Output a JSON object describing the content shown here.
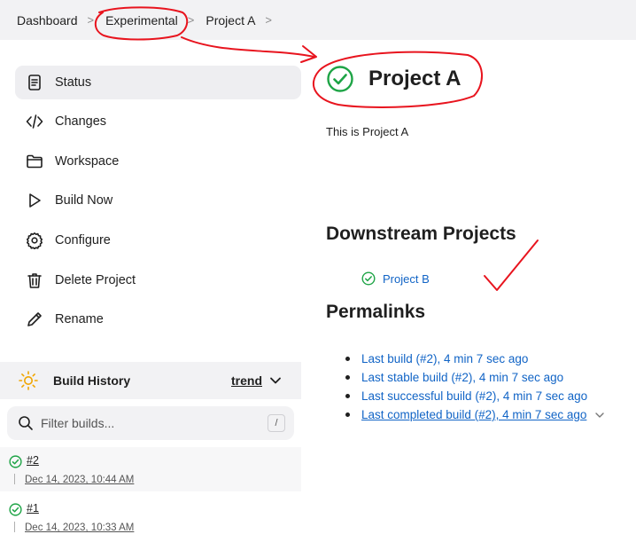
{
  "breadcrumb": {
    "items": [
      "Dashboard",
      "Experimental",
      "Project A"
    ],
    "separator": ">"
  },
  "sidebar": {
    "items": [
      {
        "label": "Status",
        "icon": "document-icon"
      },
      {
        "label": "Changes",
        "icon": "code-icon"
      },
      {
        "label": "Workspace",
        "icon": "folder-icon"
      },
      {
        "label": "Build Now",
        "icon": "play-icon"
      },
      {
        "label": "Configure",
        "icon": "gear-icon"
      },
      {
        "label": "Delete Project",
        "icon": "trash-icon"
      },
      {
        "label": "Rename",
        "icon": "pencil-icon"
      }
    ]
  },
  "build_history": {
    "title": "Build History",
    "trend_label": "trend",
    "filter_placeholder": "Filter builds...",
    "filter_shortcut": "/",
    "builds": [
      {
        "number": "#2",
        "date": "Dec 14, 2023, 10:44 AM"
      },
      {
        "number": "#1",
        "date": "Dec 14, 2023, 10:33 AM"
      }
    ]
  },
  "main": {
    "title": "Project A",
    "description": "This is Project A",
    "downstream_heading": "Downstream Projects",
    "downstream_projects": [
      "Project B"
    ],
    "permalinks_heading": "Permalinks",
    "permalinks": [
      "Last build (#2), 4 min 7 sec ago",
      "Last stable build (#2), 4 min 7 sec ago",
      "Last successful build (#2), 4 min 7 sec ago",
      "Last completed build (#2), 4 min 7 sec ago"
    ]
  },
  "colors": {
    "success": "#1ea446",
    "link": "#1164c6",
    "annotation": "#e8141e"
  }
}
